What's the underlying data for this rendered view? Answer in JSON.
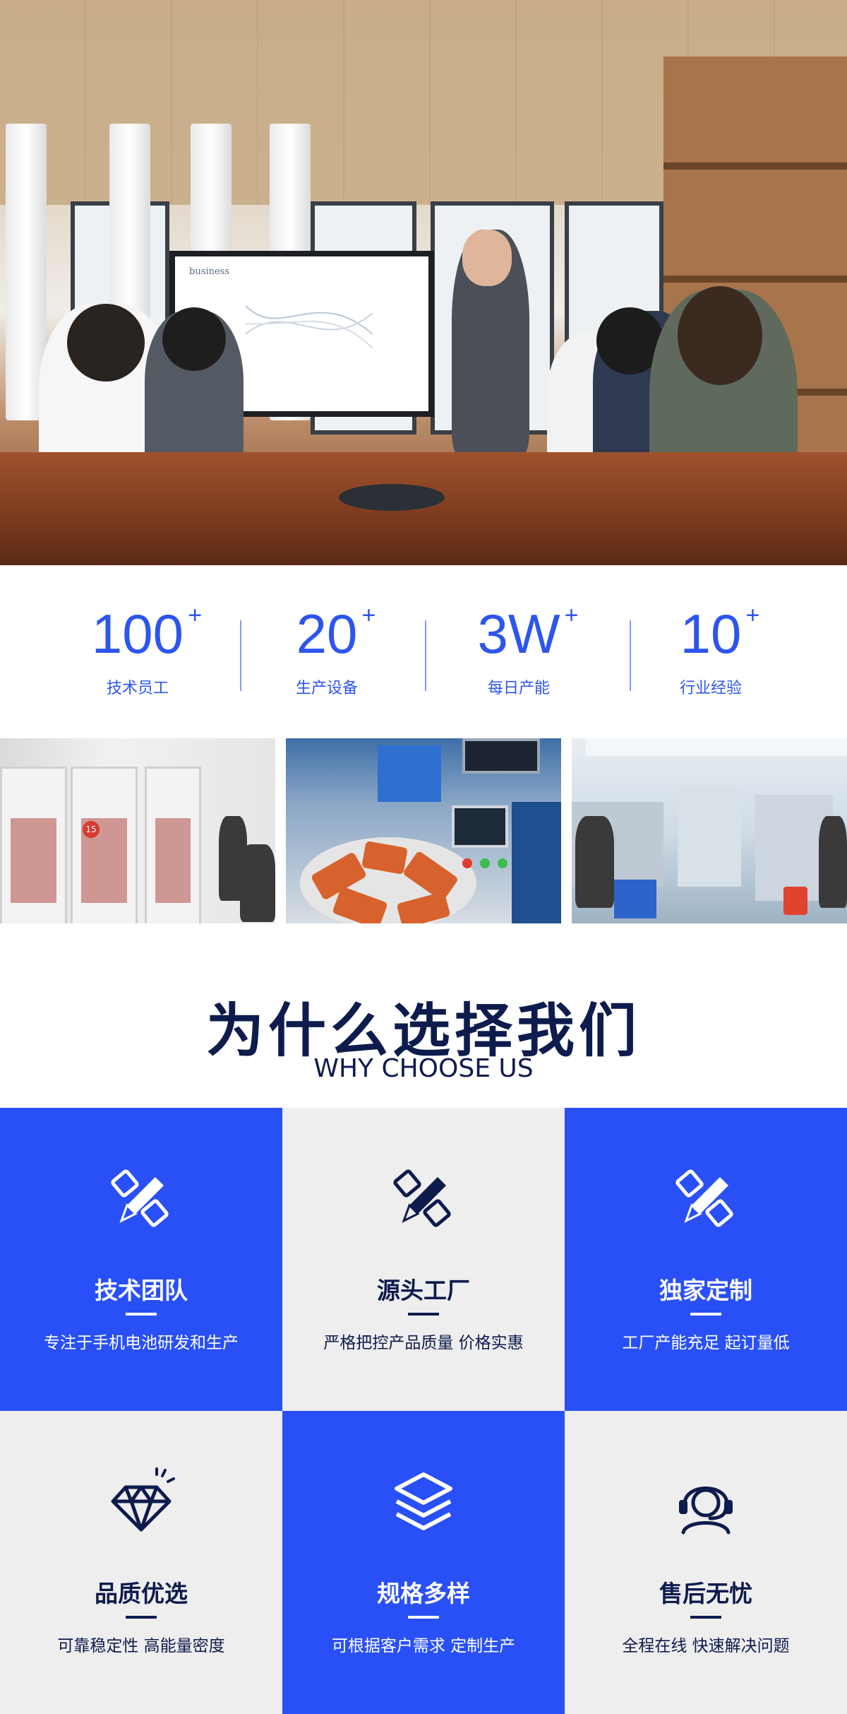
{
  "hero": {
    "screen_text": "business",
    "photo_subject": "meeting-room-presentation"
  },
  "stats": [
    {
      "number": "100",
      "suffix": "+",
      "label": "技术员工"
    },
    {
      "number": "20",
      "suffix": "+",
      "label": "生产设备"
    },
    {
      "number": "3W",
      "suffix": "+",
      "label": "每日产能"
    },
    {
      "number": "10",
      "suffix": "+",
      "label": "行业经验"
    }
  ],
  "factory_photos": {
    "badge": "15"
  },
  "why": {
    "title": "为什么选择我们",
    "subtitle": "WHY CHOOSE US"
  },
  "features": [
    {
      "title": "技术团队",
      "desc": "专注于手机电池研发和生产",
      "icon": "pencil-ruler-icon",
      "style": "blue"
    },
    {
      "title": "源头工厂",
      "desc": "严格把控产品质量 价格实惠",
      "icon": "pencil-ruler-icon",
      "style": "gray"
    },
    {
      "title": "独家定制",
      "desc": "工厂产能充足 起订量低",
      "icon": "pencil-ruler-icon",
      "style": "blue"
    },
    {
      "title": "品质优选",
      "desc": "可靠稳定性 高能量密度",
      "icon": "diamond-icon",
      "style": "gray"
    },
    {
      "title": "规格多样",
      "desc": "可根据客户需求 定制生产",
      "icon": "layers-icon",
      "style": "blue"
    },
    {
      "title": "售后无忧",
      "desc": "全程在线 快速解决问题",
      "icon": "headset-icon",
      "style": "gray"
    }
  ],
  "colors": {
    "accent_blue": "#2950f6",
    "stat_blue": "#2d55ee",
    "navy": "#0e1b4d",
    "light_gray": "#eeeeee"
  }
}
